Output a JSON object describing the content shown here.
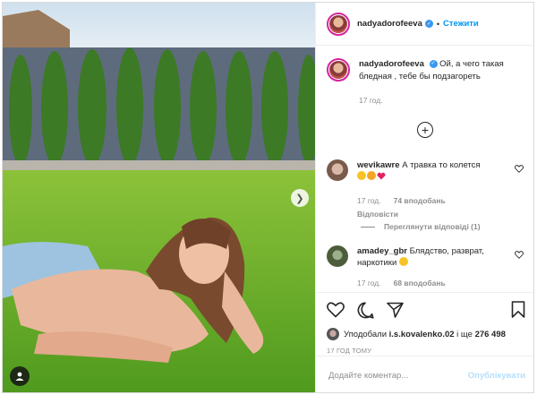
{
  "post": {
    "author": "nadyadorofeeva",
    "follow_label": "Стежити",
    "separator": "•"
  },
  "caption": {
    "author": "nadyadorofeeva",
    "text": "Ой, а чего такая бледная , тебе бы подзагореть",
    "age": "17 год."
  },
  "comments": [
    {
      "author": "wevikawre",
      "text": "А травка то колется",
      "emojis": [
        "grinning-squinting-face",
        "smiling-face-with-heart-eyes",
        "red-heart"
      ],
      "age": "17 год.",
      "likes": "74 вподобань",
      "reply_label": "Відповісти"
    },
    {
      "author": "amadey_gbr",
      "text": "Блядство, разврат, наркотики",
      "emojis": [
        "grinning-squinting-face"
      ],
      "age": "17 год.",
      "likes": "68 вподобань"
    }
  ],
  "view_replies_label": "Переглянути відповіді (1)",
  "likes_summary": {
    "prefix": "Уподобали",
    "user": "i.s.kovalenko.02",
    "connector": "і ще",
    "count": "276 498"
  },
  "timestamp": "17 ГОД ТОМУ",
  "comment_input": {
    "placeholder": "Додайте коментар..."
  },
  "publish_label": "Опублікувати",
  "icons": [
    "heart-icon",
    "comment-icon",
    "share-icon",
    "bookmark-icon",
    "plus-circle-icon",
    "chevron-right-icon",
    "user-tag-icon",
    "verified-badge-icon"
  ],
  "colors": {
    "link_blue": "#0095f6",
    "verified_blue": "#3897f0",
    "publish_disabled": "#b2dffc",
    "muted": "#8e8e8e"
  }
}
